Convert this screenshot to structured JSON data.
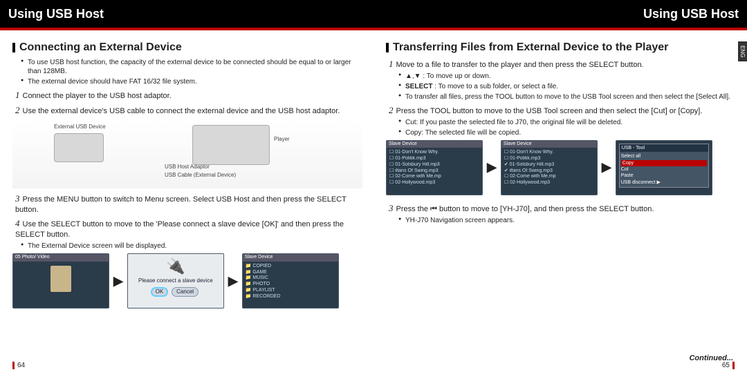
{
  "header": {
    "left": "Using USB Host",
    "right": "Using USB Host"
  },
  "lang_tab": "ENG",
  "left": {
    "h2": "Connecting an External Device",
    "notes": [
      "To use USB host function, the capacity of the external device to be connected should be equal to or larger than 128MB.",
      "The external device should have FAT 16/32 file system."
    ],
    "steps": [
      {
        "n": "1",
        "t": "Connect the player to the USB host adaptor."
      },
      {
        "n": "2",
        "t": "Use the external device's USB cable to connect the external device and the USB host adaptor."
      },
      {
        "n": "3",
        "t": "Press the MENU button to switch to Menu screen. Select USB Host and then press the SELECT button."
      },
      {
        "n": "4",
        "t": "Use the SELECT button to move to the 'Please connect a slave device [OK]' and then press the SELECT button."
      }
    ],
    "diagram": {
      "ext_label": "External USB Device",
      "player_label": "Player",
      "adaptor_label": "USB Host Adaptor",
      "cable_label": "USB Cable (External Device)"
    },
    "after_steps_note": "The External Device screen will be displayed.",
    "screens": {
      "menu": {
        "title": "05  Photo/ Video"
      },
      "dialog": {
        "msg": "Please connect a slave device",
        "ok": "OK",
        "cancel": "Cancel"
      },
      "slave": {
        "title": "Slave Device",
        "items": [
          "COPIED",
          "GAME",
          "MUSIC",
          "PHOTO",
          "PLAYLIST",
          "RECORDED"
        ]
      }
    },
    "page": "64"
  },
  "right": {
    "h2": "Transferring Files from External Device to the Player",
    "steps": [
      {
        "n": "1",
        "t": "Move to a file to transfer to the player and then press the SELECT button.",
        "subs": [
          "▲,▼ : To move up or down.",
          "SELECT : To move to a sub folder, or select a file.",
          "To transfer all files, press the TOOL button to move to the USB Tool screen and then select the [Select All]."
        ]
      },
      {
        "n": "2",
        "t": "Press the TOOL button to move to the USB Tool screen and then select the [Cut] or [Copy].",
        "subs": [
          "Cut: If you paste the selected file to J70, the original file will be deleted.",
          "Copy: The selected file will be copied."
        ]
      },
      {
        "n": "3",
        "t": "Press the ⏮ button to move to [YH-J70], and then press the SELECT button.",
        "subs": [
          "YH-J70 Navigation screen appears."
        ]
      }
    ],
    "screens": {
      "slave1": {
        "title": "Slave Device",
        "items": [
          "01-Don't Know Why.",
          "01-Politik.mp3",
          "01-Solsbury Hill.mp3",
          "iltans Of Swing.mp3",
          "02-Come with Me.mp",
          "02-Hollywood.mp3"
        ]
      },
      "slave2": {
        "title": "Slave Device",
        "items": [
          "01-Don't Know Why.",
          "01-Politik.mp3",
          "01-Solsbury Hill.mp3",
          "iltans Of Swing.mp3",
          "02-Come with Me.mp",
          "02-Hollywood.mp3"
        ],
        "checked": [
          2,
          3
        ]
      },
      "usbtool": {
        "title": "USB - Tool",
        "items": [
          "Select all",
          "Copy",
          "Cut",
          "Paste",
          "USB disconnect"
        ],
        "hi": 1
      }
    },
    "continued": "Continued...",
    "page": "65"
  }
}
